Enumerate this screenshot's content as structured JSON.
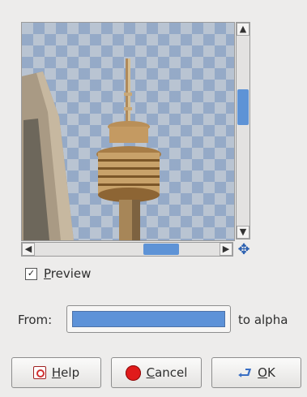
{
  "preview_area": {
    "scroll_up": "▲",
    "scroll_down": "▼",
    "scroll_left": "◀",
    "scroll_right": "▶",
    "navigate_icon": "move-icon"
  },
  "preview_toggle": {
    "label_accel": "P",
    "label_rest": "review",
    "checked": true,
    "check_mark": "✓"
  },
  "from_row": {
    "label": "From:",
    "color": "#5d92d8",
    "suffix": "to alpha"
  },
  "buttons": {
    "help": {
      "accel": "H",
      "rest": "elp"
    },
    "cancel": {
      "accel": "C",
      "rest": "ancel"
    },
    "ok": {
      "accel": "O",
      "rest": "K"
    }
  },
  "colors": {
    "accent": "#5e93d6",
    "background": "#edeceb"
  }
}
